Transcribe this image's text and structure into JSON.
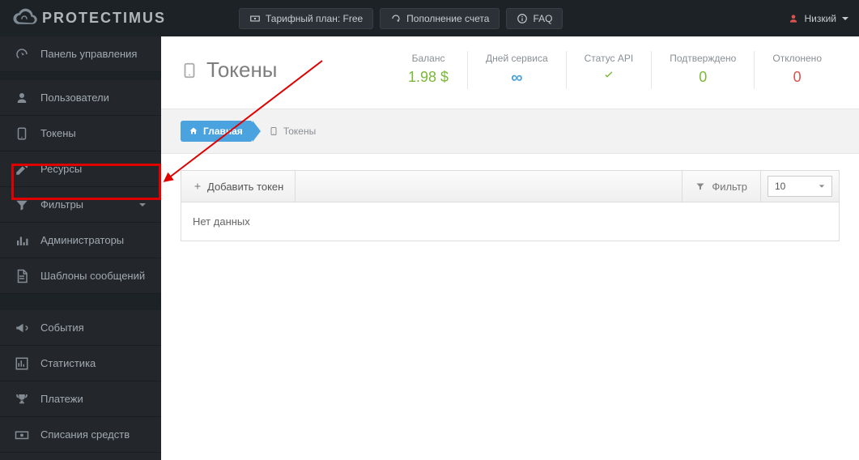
{
  "brand": "PROTECTIMUS",
  "topbar": {
    "plan_label": "Тарифный план: Free",
    "topup_label": "Пополнение счета",
    "faq_label": "FAQ",
    "user_label": "Низкий"
  },
  "sidebar": {
    "dashboard": "Панель управления",
    "users": "Пользователи",
    "tokens": "Токены",
    "resources": "Ресурсы",
    "filters": "Фильтры",
    "admins": "Администраторы",
    "templates": "Шаблоны сообщений",
    "events": "События",
    "stats": "Статистика",
    "payments": "Платежи",
    "charges": "Списания средств"
  },
  "page": {
    "title": "Токены",
    "stats": {
      "balance_label": "Баланс",
      "balance_value": "1.98 $",
      "days_label": "Дней сервиса",
      "days_value": "∞",
      "api_label": "Статус API",
      "confirmed_label": "Подтверждено",
      "confirmed_value": "0",
      "declined_label": "Отклонено",
      "declined_value": "0"
    }
  },
  "crumbs": {
    "home": "Главная",
    "tokens": "Токены"
  },
  "toolbar": {
    "add_label": "Добавить токен",
    "filter_label": "Фильтр",
    "page_size": "10"
  },
  "table": {
    "empty": "Нет данных"
  }
}
